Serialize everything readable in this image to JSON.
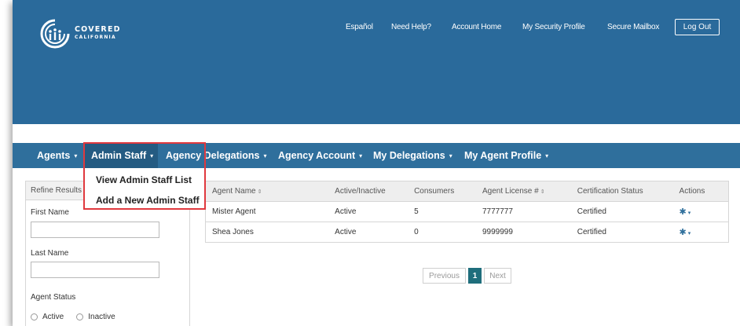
{
  "brand": {
    "line1": "COVERED",
    "line2": "CALIFORNIA"
  },
  "toplinks": [
    "Español",
    "Need Help?",
    "Account Home",
    "My Security Profile",
    "Secure Mailbox"
  ],
  "logout_label": "Log Out",
  "nav": {
    "items": [
      "Agents",
      "Admin Staff",
      "Agency Delegations",
      "Agency Account",
      "My Delegations",
      "My Agent Profile"
    ],
    "active_index": 1,
    "caret": "▾"
  },
  "dropdown": {
    "items": [
      "View Admin Staff List",
      "Add a New Admin Staff"
    ]
  },
  "sidebar": {
    "title": "Refine Results",
    "first_name_label": "First Name",
    "first_name_value": "",
    "last_name_label": "Last Name",
    "last_name_value": "",
    "status_label": "Agent Status",
    "status_options": [
      "Active",
      "Inactive"
    ]
  },
  "table": {
    "headers": [
      "Agent Name",
      "Active/Inactive",
      "Consumers",
      "Agent License #",
      "Certification Status",
      "Actions"
    ],
    "rows": [
      [
        "Mister Agent",
        "Active",
        "5",
        "7777777",
        "Certified"
      ],
      [
        "Shea Jones",
        "Active",
        "0",
        "9999999",
        "Certified"
      ]
    ]
  },
  "pagination": {
    "prev": "Previous",
    "current": "1",
    "next": "Next"
  },
  "colors": {
    "header": "#2a6a9b",
    "nav": "#2f6f9c",
    "highlight": "#e0393e",
    "page_active": "#1f6e7c"
  }
}
